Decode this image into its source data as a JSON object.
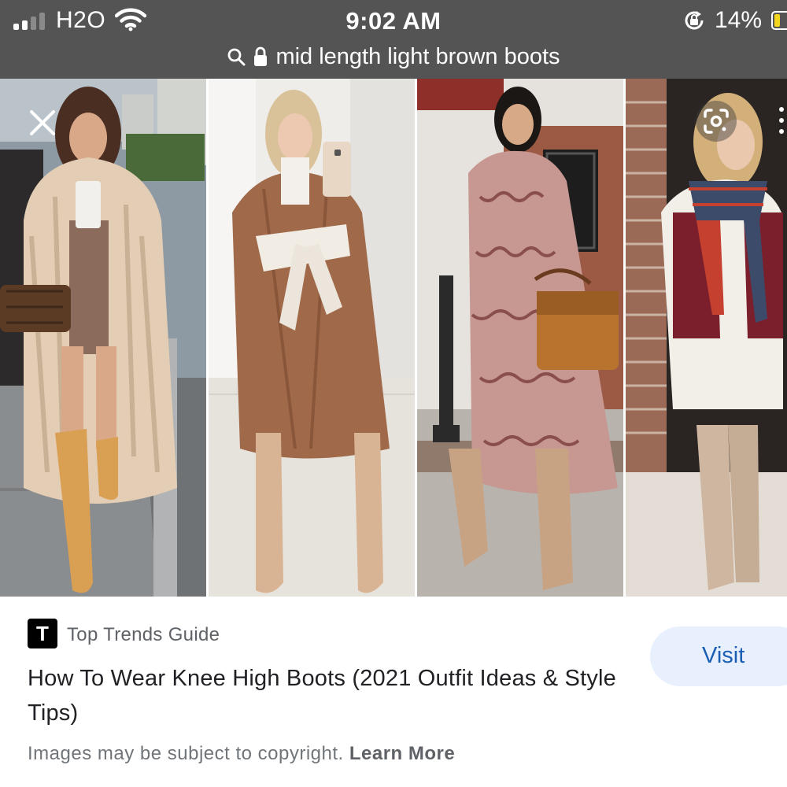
{
  "status_bar": {
    "carrier": "H2O",
    "time": "9:02 AM",
    "battery_percent": "14%",
    "battery_level": 0.14,
    "signal_bars": 2
  },
  "address_bar": {
    "query": "mid length light brown boots",
    "icons": [
      "search-icon",
      "lock-icon"
    ]
  },
  "viewer": {
    "close_icon": "close-icon",
    "lens_icon": "google-lens-icon",
    "more_icon": "more-vertical-icon",
    "images": [
      "woman in faux fur coat and tan western boots",
      "woman in camel wrap coat and nude knee high boots",
      "woman in paisley dress with brown handbag and tan boots",
      "woman in plaid scarf, burgundy vest and taupe boots"
    ]
  },
  "result": {
    "source_initial": "T",
    "source_name": "Top Trends Guide",
    "title": "How To Wear Knee High Boots (2021 Outfit Ideas & Style Tips)",
    "visit_label": "Visit",
    "copyright_text": "Images may be subject to copyright.",
    "learn_more_label": "Learn More"
  },
  "colors": {
    "top_bar": "#545454",
    "visit_bg": "#e8f0fe",
    "visit_text": "#1a5fb4",
    "battery_fill": "#f3d51e"
  }
}
